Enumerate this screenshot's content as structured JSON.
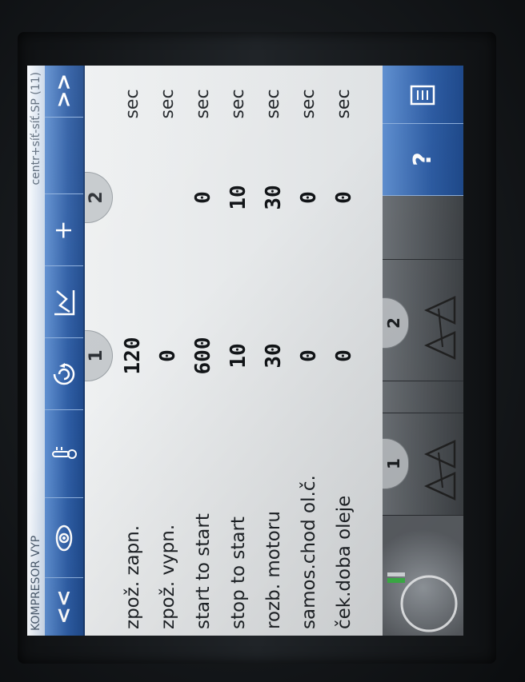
{
  "window": {
    "title": "KOMPRESOR VYP",
    "context": "centr+síť-síť.SP (11)"
  },
  "toolbar": {
    "prev": "<<",
    "next": ">>",
    "buttons": [
      {
        "icon": "eye-icon"
      },
      {
        "icon": "thermometer-icon"
      },
      {
        "icon": "cycle-icon"
      },
      {
        "icon": "trend-icon"
      },
      {
        "icon": "plus-icon",
        "label": "+"
      }
    ]
  },
  "columns": {
    "tab1": "1",
    "tab2": "2"
  },
  "rows": [
    {
      "label": "zpož. zapn.",
      "v1": "120",
      "v2": "",
      "unit": "sec"
    },
    {
      "label": "zpož. vypn.",
      "v1": "0",
      "v2": "",
      "unit": "sec"
    },
    {
      "label": "start to start",
      "v1": "600",
      "v2": "0",
      "unit": "sec"
    },
    {
      "label": "stop to start",
      "v1": "10",
      "v2": "10",
      "unit": "sec"
    },
    {
      "label": "rozb. motoru",
      "v1": "30",
      "v2": "30",
      "unit": "sec"
    },
    {
      "label": "samos.chod  ol.č.",
      "v1": "0",
      "v2": "0",
      "unit": "sec"
    },
    {
      "label": "ček.doba oleje",
      "v1": "0",
      "v2": "0",
      "unit": "sec"
    }
  ],
  "bottom": {
    "tab1": "1",
    "tab2": "2",
    "help": "?"
  }
}
